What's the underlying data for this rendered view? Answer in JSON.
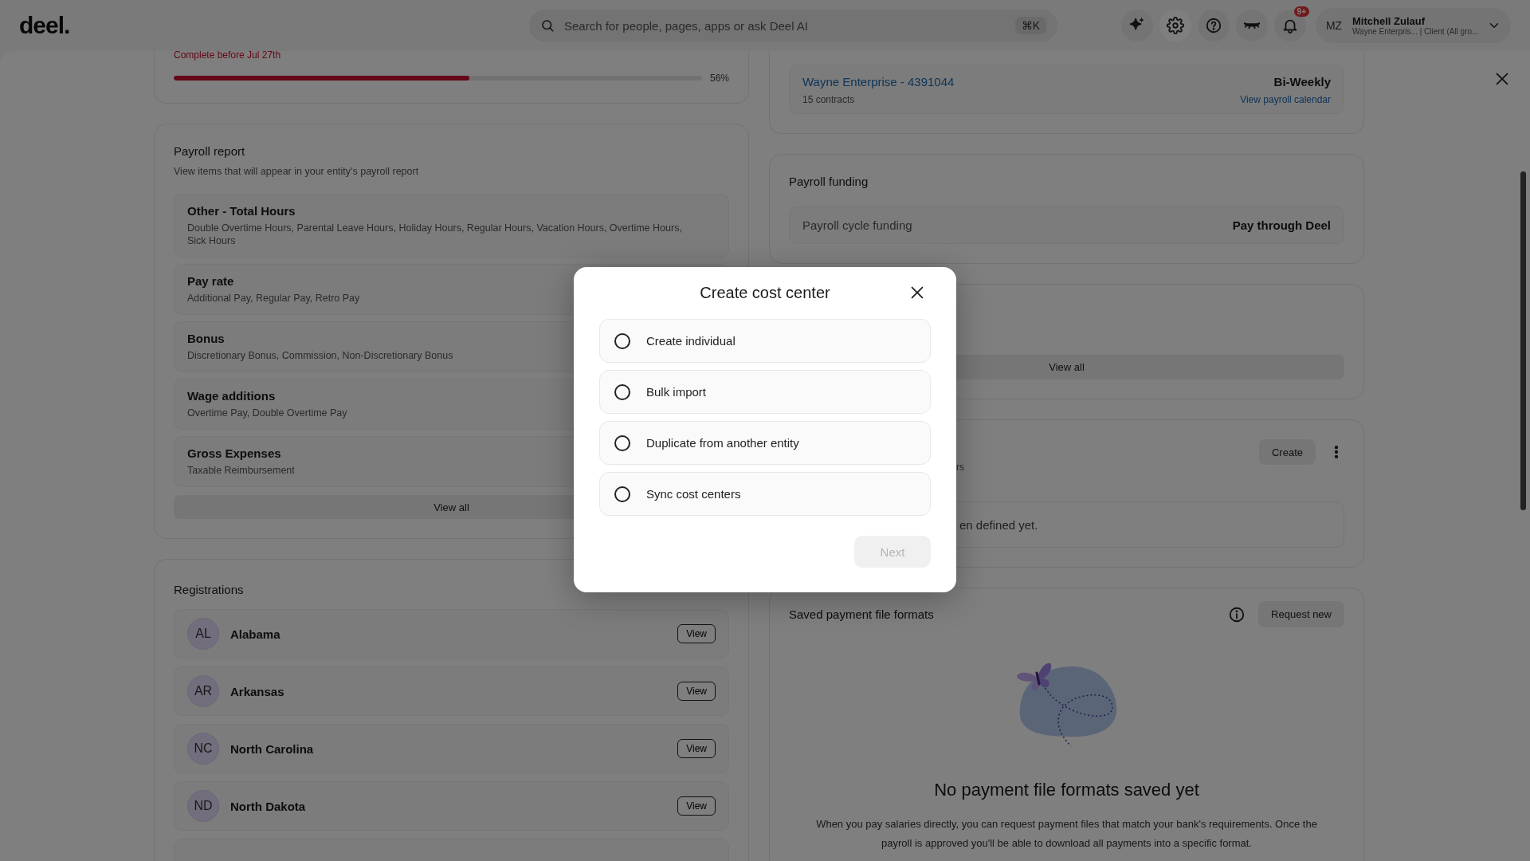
{
  "top_bar": {
    "logo": "deel.",
    "search": {
      "placeholder": "Search for people, pages, apps or ask Deel AI",
      "shortcut": "⌘K"
    },
    "notifications_badge": "9+",
    "user": {
      "initials": "MZ",
      "name": "Mitchell Zulauf",
      "subtitle": "Wayne Enterpris... | Client (All gro..."
    }
  },
  "progress": {
    "deadline": "Complete before Jul 27th",
    "level": 0.56,
    "reading": "56%"
  },
  "payroll_report": {
    "title": "Payroll report",
    "subtitle": "View items that will appear in your entity's payroll report",
    "items": [
      {
        "title": "Other - Total Hours",
        "details": "Double Overtime Hours, Parental Leave Hours, Holiday Hours, Regular Hours, Vacation Hours, Overtime Hours, Sick Hours"
      },
      {
        "title": "Pay rate",
        "details": "Additional Pay, Regular Pay, Retro Pay"
      },
      {
        "title": "Bonus",
        "details": "Discretionary Bonus, Commission, Non-Discretionary Bonus"
      },
      {
        "title": "Wage additions",
        "details": "Overtime Pay, Double Overtime Pay"
      },
      {
        "title": "Gross Expenses",
        "details": "Taxable Reimbursement"
      }
    ],
    "view_all": "View all"
  },
  "registrations": {
    "title": "Registrations",
    "items": [
      {
        "initials": "AL",
        "name": "Alabama",
        "action": "View"
      },
      {
        "initials": "AR",
        "name": "Arkansas",
        "action": "View"
      },
      {
        "initials": "NC",
        "name": "North Carolina",
        "action": "View"
      },
      {
        "initials": "ND",
        "name": "North Dakota",
        "action": "View"
      }
    ]
  },
  "payroll_group": {
    "name": "Wayne Enterprise - 4391044",
    "contracts": "15 contracts",
    "frequency": "Bi-Weekly",
    "calendar_link": "View payroll calendar"
  },
  "payroll_funding": {
    "title": "Payroll funding",
    "label": "Payroll cycle funding",
    "value": "Pay through Deel"
  },
  "covered_card": {
    "view_all": "View all"
  },
  "cost_centers": {
    "create": "Create",
    "subtitle_fragment": "rs",
    "empty_fragment": "en defined yet."
  },
  "payment_formats": {
    "title": "Saved payment file formats",
    "request": "Request new",
    "empty_title": "No payment file formats saved yet",
    "empty_text": "When you pay salaries directly, you can request payment files that match your bank's requirements. Once the payroll is approved you'll be able to download all payments into a specific format."
  },
  "dialog": {
    "title": "Create cost center",
    "options": [
      {
        "label": "Create individual",
        "selected": false
      },
      {
        "label": "Bulk import",
        "selected": false
      },
      {
        "label": "Duplicate from another entity",
        "selected": false
      },
      {
        "label": "Sync cost centers",
        "selected": false
      }
    ],
    "next": {
      "label": "Next",
      "disabled": true
    }
  }
}
